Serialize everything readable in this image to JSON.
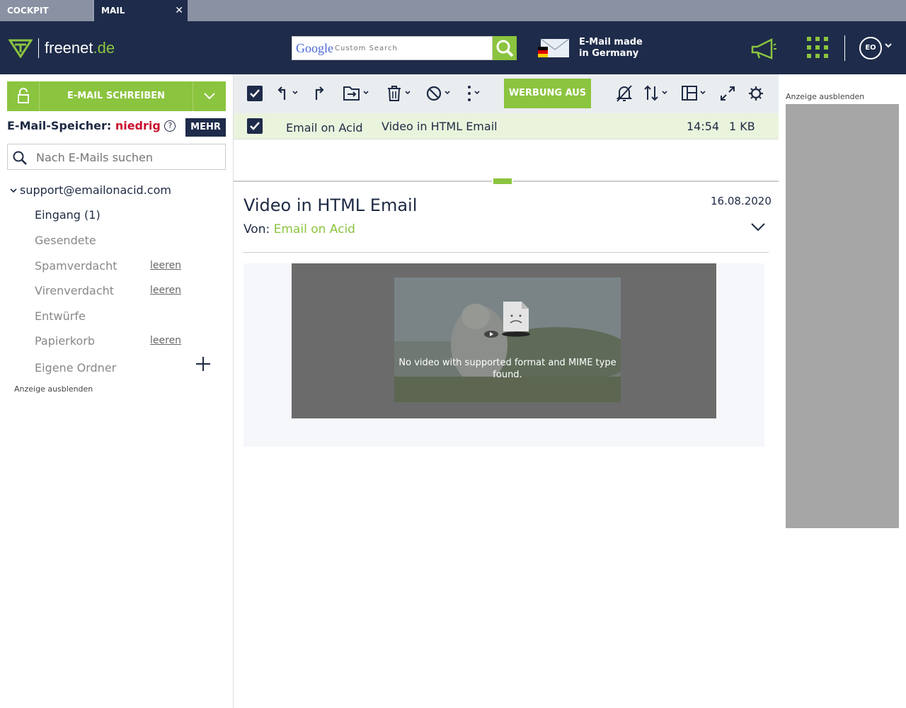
{
  "tabs": {
    "cockpit": "COCKPIT",
    "mail": "MAIL",
    "close": "✕"
  },
  "header": {
    "brand": "freenet",
    "brand_tld": ".de",
    "google_logo": "Google",
    "search_placeholder": "Custom Search",
    "germany_line1": "E-Mail made",
    "germany_line2": "in Germany",
    "avatar_initials": "EO"
  },
  "sidebar": {
    "compose_label": "E-MAIL SCHREIBEN",
    "storage_label": "E-Mail-Speicher:",
    "storage_value": "niedrig",
    "storage_help": "?",
    "mehr": "MEHR",
    "search_placeholder": "Nach E-Mails suchen",
    "account": "support@emailonacid.com",
    "folders": [
      {
        "label": "Eingang (1)"
      },
      {
        "label": "Gesendete"
      },
      {
        "label": "Spamverdacht",
        "action": "leeren"
      },
      {
        "label": "Virenverdacht",
        "action": "leeren"
      },
      {
        "label": "Entwürfe"
      },
      {
        "label": "Papierkorb",
        "action": "leeren"
      },
      {
        "label": "Eigene Ordner"
      }
    ],
    "hide_ad": "Anzeige ausblenden"
  },
  "toolbar": {
    "werbung_aus": "WERBUNG AUS"
  },
  "mail_list": [
    {
      "sender": "Email on Acid",
      "subject": "Video in HTML Email",
      "time": "14:54",
      "size": "1 KB"
    }
  ],
  "message": {
    "subject": "Video in HTML Email",
    "date": "16.08.2020",
    "from_label": "Von:",
    "from_name": "Email on Acid",
    "video_error": "No video with supported format and MIME type found."
  },
  "right_ad": {
    "hide_label": "Anzeige ausblenden"
  },
  "colors": {
    "navy": "#1e2b4a",
    "green": "#8bc43f",
    "red": "#c8102e",
    "ad_gray": "#a6a6a6"
  },
  "icons": [
    "freenet-logo-icon",
    "google-search-icon",
    "germany-mail-icon",
    "megaphone-icon",
    "apps-grid-icon",
    "chevron-down-icon",
    "lock-icon",
    "search-icon",
    "plus-icon",
    "checkbox-icon",
    "reply-icon",
    "forward-icon",
    "move-icon",
    "trash-icon",
    "block-icon",
    "more-icon",
    "notifications-off-icon",
    "sort-icon",
    "layout-icon",
    "fullscreen-icon",
    "settings-icon",
    "broken-file-icon"
  ]
}
